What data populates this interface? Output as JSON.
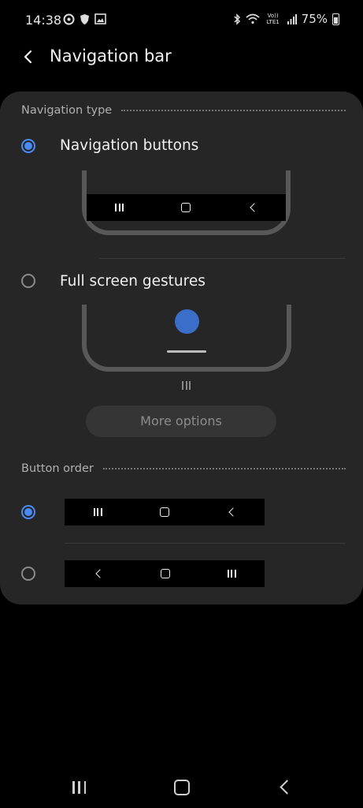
{
  "status_bar": {
    "time": "14:38",
    "battery": "75%",
    "network_label": "Vo)) LTE1",
    "icons_left": [
      "sync-icon",
      "shield-icon",
      "image-icon"
    ],
    "icons_right": [
      "bluetooth-icon",
      "wifi-icon",
      "signal-icon",
      "battery-icon"
    ]
  },
  "header": {
    "title": "Navigation bar",
    "back_icon": "chevron-left-icon"
  },
  "navigation_type": {
    "section_title": "Navigation type",
    "options": [
      {
        "label": "Navigation buttons",
        "selected": true
      },
      {
        "label": "Full screen gestures",
        "selected": false
      }
    ],
    "more_options_label": "More options"
  },
  "button_order": {
    "section_title": "Button order",
    "options": [
      {
        "order": [
          "recent-apps-icon",
          "home-icon",
          "back-icon"
        ],
        "selected": true
      },
      {
        "order": [
          "back-icon",
          "home-icon",
          "recent-apps-icon"
        ],
        "selected": false
      }
    ]
  },
  "bottom_nav": {
    "items": [
      "recent-apps-icon",
      "home-icon",
      "back-icon"
    ]
  },
  "colors": {
    "accent": "#4a8bf5",
    "card_background": "#262626",
    "page_background": "#000000"
  }
}
